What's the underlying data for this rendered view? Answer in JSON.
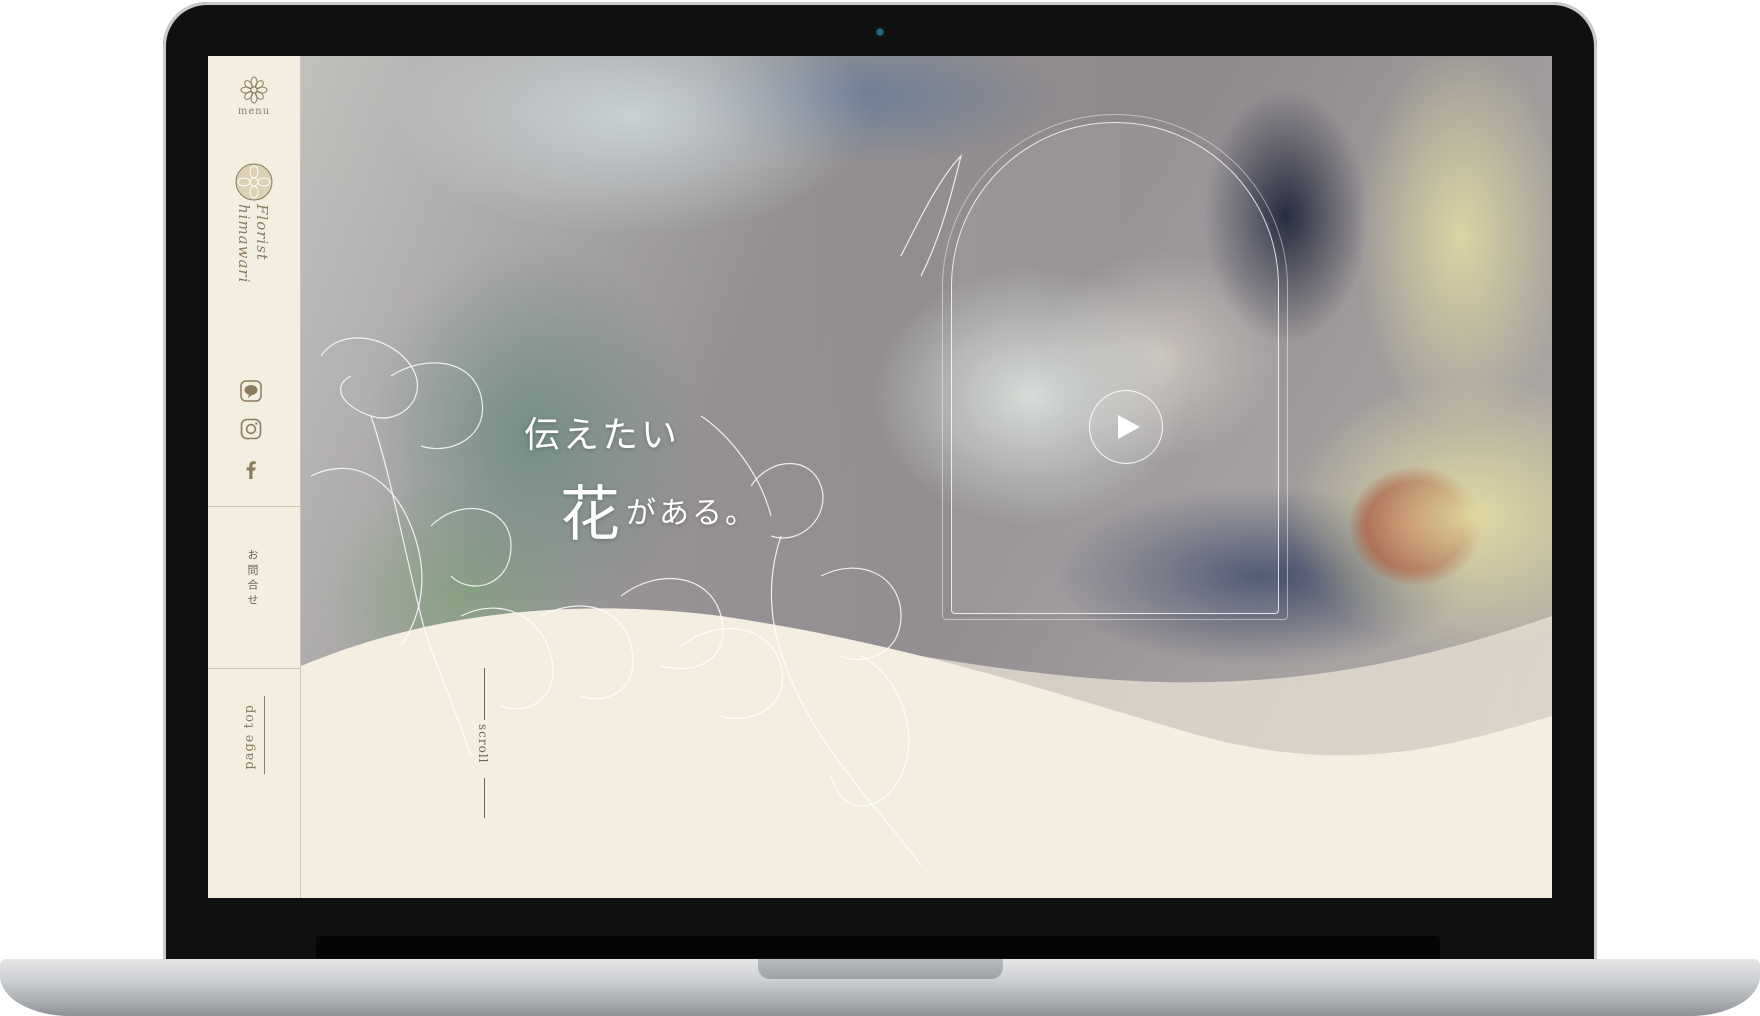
{
  "sidebar": {
    "menu_label": "menu",
    "logo_text": "Florist himawari",
    "social_icons": [
      "line-icon",
      "instagram-icon",
      "facebook-icon"
    ],
    "contact_label": "お問合せ",
    "page_top_label": "page top"
  },
  "hero": {
    "catch_line1": "伝えたい",
    "catch_main": "花",
    "catch_rest": "がある。",
    "scroll_label": "scroll",
    "play_icon": "play-icon"
  },
  "colors": {
    "cream": "#f4eee1",
    "brown": "#8b7c5f",
    "line": "#cfc4ae",
    "white": "#ffffff"
  }
}
